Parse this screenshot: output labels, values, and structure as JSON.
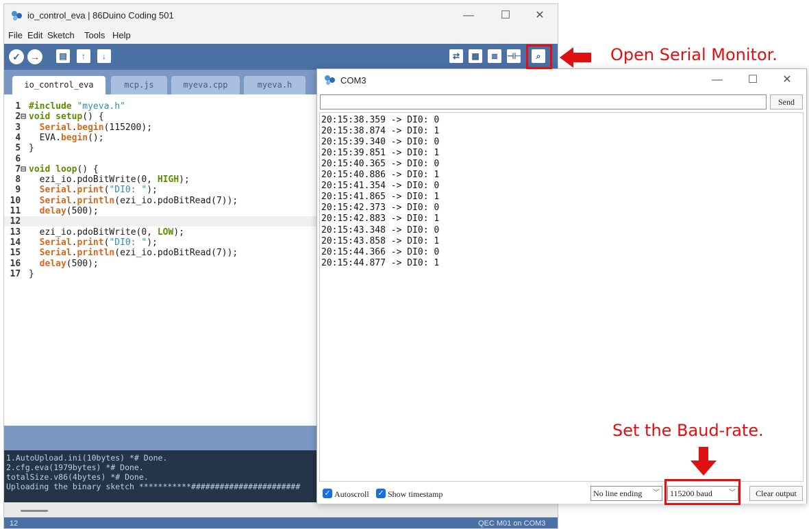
{
  "ide": {
    "window_title": "io_control_eva | 86Duino Coding 501",
    "menu": [
      "File",
      "Edit",
      "Sketch",
      "Tools",
      "Help"
    ],
    "toolbar_left": {
      "verify_icon": "✓",
      "upload_icon": "→",
      "new_icon": "▤",
      "open_icon": "↑",
      "save_icon": "↓"
    },
    "toolbar_right": {
      "icon1": "⇄",
      "icon2": "▦",
      "icon3": "≣",
      "icon4": "⊣⊢",
      "serial_icon": "⌕"
    },
    "tabs": [
      "io_control_eva",
      "mcp.js",
      "myeva.cpp",
      "myeva.h"
    ],
    "code_lines": [
      {
        "n": "1",
        "fold": "",
        "html": "<span class='pp'>#include</span> <span class='str'>\"myeva.h\"</span>"
      },
      {
        "n": "2",
        "fold": "⊟",
        "html": "<span class='kw'>void</span> <span class='kw'>setup</span>() {"
      },
      {
        "n": "3",
        "fold": "",
        "html": "  <span class='fn'>Serial</span>.<span class='fn'>begin</span>(115200);"
      },
      {
        "n": "4",
        "fold": "",
        "html": "  EVA.<span class='fn'>begin</span>();"
      },
      {
        "n": "5",
        "fold": "",
        "html": "}"
      },
      {
        "n": "6",
        "fold": "",
        "html": ""
      },
      {
        "n": "7",
        "fold": "⊟",
        "html": "<span class='kw'>void</span> <span class='kw'>loop</span>() {"
      },
      {
        "n": "8",
        "fold": "",
        "html": "  ezi_io.pdoBitWrite(0, <span class='kw'>HIGH</span>);"
      },
      {
        "n": "9",
        "fold": "",
        "html": "  <span class='fn'>Serial</span>.<span class='fn'>print</span>(<span class='str'>\"DI0: \"</span>);"
      },
      {
        "n": "10",
        "fold": "",
        "html": "  <span class='fn'>Serial</span>.<span class='fn'>println</span>(ezi_io.pdoBitRead(7));"
      },
      {
        "n": "11",
        "fold": "",
        "html": "  <span class='fn'>delay</span>(500);"
      },
      {
        "n": "12",
        "fold": "",
        "html": ""
      },
      {
        "n": "13",
        "fold": "",
        "html": "  ezi_io.pdoBitWrite(0, <span class='kw'>LOW</span>);"
      },
      {
        "n": "14",
        "fold": "",
        "html": "  <span class='fn'>Serial</span>.<span class='fn'>print</span>(<span class='str'>\"DI0: \"</span>);"
      },
      {
        "n": "15",
        "fold": "",
        "html": "  <span class='fn'>Serial</span>.<span class='fn'>println</span>(ezi_io.pdoBitRead(7));"
      },
      {
        "n": "16",
        "fold": "",
        "html": "  <span class='fn'>delay</span>(500);"
      },
      {
        "n": "17",
        "fold": "",
        "html": "}"
      }
    ],
    "console_lines": [
      "1.AutoUpload.ini(10bytes) *# Done.",
      "2.cfg.eva(1979bytes) *# Done.",
      "totalSize.v86(4bytes) *# Done.",
      "Uploading the binary sketch ***********#######################"
    ],
    "footer_line": "12",
    "footer_board": "QEC M01 on COM3"
  },
  "serial": {
    "title": "COM3",
    "send_label": "Send",
    "input_value": "",
    "output_lines": [
      "20:15:38.359 -> DI0: 0",
      "20:15:38.874 -> DI0: 1",
      "20:15:39.340 -> DI0: 0",
      "20:15:39.851 -> DI0: 1",
      "20:15:40.365 -> DI0: 0",
      "20:15:40.886 -> DI0: 1",
      "20:15:41.354 -> DI0: 0",
      "20:15:41.865 -> DI0: 1",
      "20:15:42.373 -> DI0: 0",
      "20:15:42.883 -> DI0: 1",
      "20:15:43.348 -> DI0: 0",
      "20:15:43.858 -> DI0: 1",
      "20:15:44.366 -> DI0: 0",
      "20:15:44.877 -> DI0: 1"
    ],
    "autoscroll_label": "Autoscroll",
    "autoscroll_checked": true,
    "timestamp_label": "Show timestamp",
    "timestamp_checked": true,
    "line_ending": "No line ending",
    "baud": "115200 baud",
    "clear_label": "Clear output"
  },
  "window_controls": {
    "minimize": "—",
    "maximize": "☐",
    "close": "✕"
  },
  "annotations": {
    "open_serial": "Open Serial Monitor.",
    "set_baud": "Set the Baud-rate.",
    "color": "#e01010"
  }
}
